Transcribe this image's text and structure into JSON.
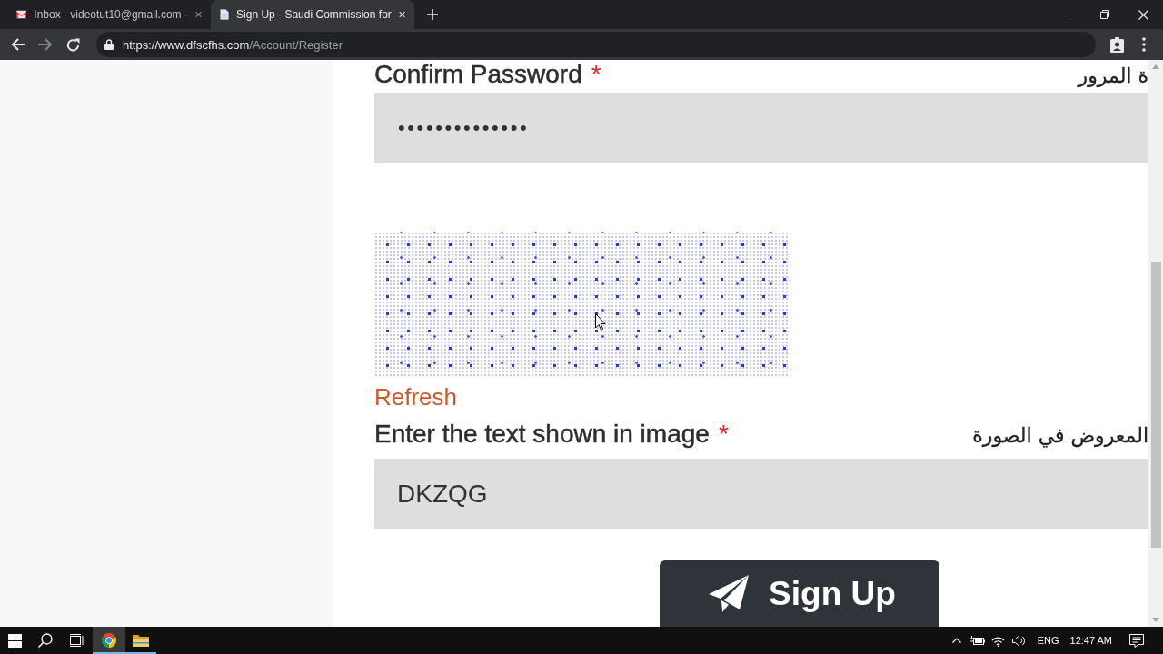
{
  "browser": {
    "tabs": [
      {
        "kind": "mail",
        "title": "Inbox - videotut10@gmail.com -",
        "selected": false
      },
      {
        "kind": "page",
        "title": "Sign Up - Saudi Commission for",
        "selected": true
      }
    ],
    "forward_button": {
      "disabled": true
    },
    "address_bar": {
      "host": "https://www.dfscfhs.com",
      "path": "/Account/Register"
    }
  },
  "form": {
    "confirm_password": {
      "label": "Confirm Password",
      "required_mark": "*",
      "label_ar": "ة المرور",
      "value": "••••••••••••••"
    },
    "captcha": {
      "refresh_link": "Refresh"
    },
    "captcha_answer": {
      "label": "Enter the text shown in image",
      "required_mark": "*",
      "label_ar": "المعروض في الصورة",
      "value": "DKZQG"
    },
    "submit_button": {
      "label": "Sign Up"
    }
  },
  "taskbar": {
    "apps": [
      {
        "kind": "browser",
        "selected": true
      },
      {
        "kind": "folder",
        "selected": false
      }
    ],
    "language": "ENG",
    "time": "12:47 AM"
  }
}
